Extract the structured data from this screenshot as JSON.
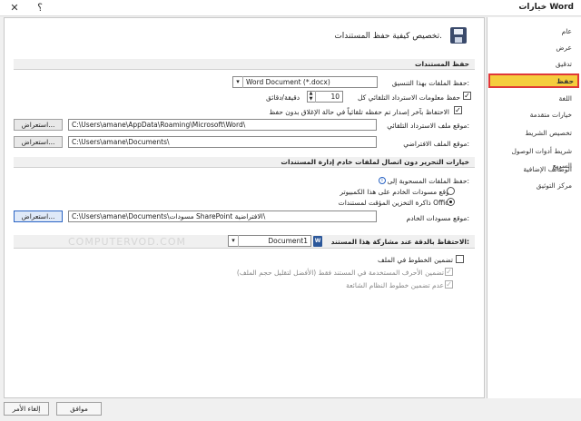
{
  "window": {
    "title": "خيارات Word",
    "help_label": "؟",
    "close_label": "✕"
  },
  "sidebar": {
    "items": [
      {
        "label": "عام"
      },
      {
        "label": "عرض"
      },
      {
        "label": "تدقيق"
      },
      {
        "label": "حفظ"
      },
      {
        "label": "اللغة"
      },
      {
        "label": "خيارات متقدمة"
      },
      {
        "label": "تخصيص الشريط"
      },
      {
        "label": "شريط أدوات الوصول السريع"
      },
      {
        "label": "الوظائف الإضافية"
      },
      {
        "label": "مركز التوثيق"
      }
    ],
    "active_index": 3
  },
  "header": {
    "description": "تخصيص كيفية حفظ المستندات."
  },
  "save_documents": {
    "section_title": "حفظ المستندات",
    "format_label": "حفظ الملفات بهذا التنسيق:",
    "format_value": "Word Document (*.docx)",
    "autorecover_label": "حفظ معلومات الاسترداد التلقائي كل",
    "autorecover_minutes": "10",
    "minutes_label": "دقيقة/دقائق",
    "keep_last_label": "الاحتفاظ بآخر إصدار تم حفظه تلقائياً في حالة الإغلاق بدون حفظ",
    "autorecover_location_label": "موقع ملف الاسترداد التلقائي:",
    "autorecover_location_value": "C:\\Users\\amane\\AppData\\Roaming\\Microsoft\\Word\\",
    "default_location_label": "موقع الملف الافتراضي:",
    "default_location_value": "C:\\Users\\amane\\Documents\\",
    "browse_label": "استعراض..."
  },
  "offline_editing": {
    "section_title": "خيارات التحرير دون اتصال لملفات خادم إدارة المستندات",
    "info_icon": "info-icon",
    "save_checkedout_label": "حفظ الملفات المسحوبة إلى:",
    "option_server_label": "موقع مسودات الخادم على هذا الكمبيوتر",
    "option_cache_label": "ذاكرة التخزين المؤقت لمستندات Office",
    "server_drafts_label": "موقع مسودات الخادم:",
    "server_drafts_value": "C:\\Users\\amane\\Documents\\مسودات SharePoint الافتراضية\\",
    "browse_label": "استعراض..."
  },
  "fidelity": {
    "section_title": "الاحتفاظ بالدقة عند مشاركة هذا المستند:",
    "document_value": "Document1",
    "embed_fonts_label": "تضمين الخطوط في الملف",
    "embed_chars_label": "تضمين الأحرف المستخدمة في المستند فقط (الأفضل لتقليل حجم الملف)",
    "no_common_fonts_label": "عدم تضمين خطوط النظام الشائعة"
  },
  "watermark": "COMPUTERVOD.COM",
  "footer": {
    "ok_label": "موافق",
    "cancel_label": "إلغاء الأمر"
  },
  "colors": {
    "active_bg": "#f5cd3d",
    "active_border": "#e03838",
    "focus_border": "#2a64c4"
  }
}
